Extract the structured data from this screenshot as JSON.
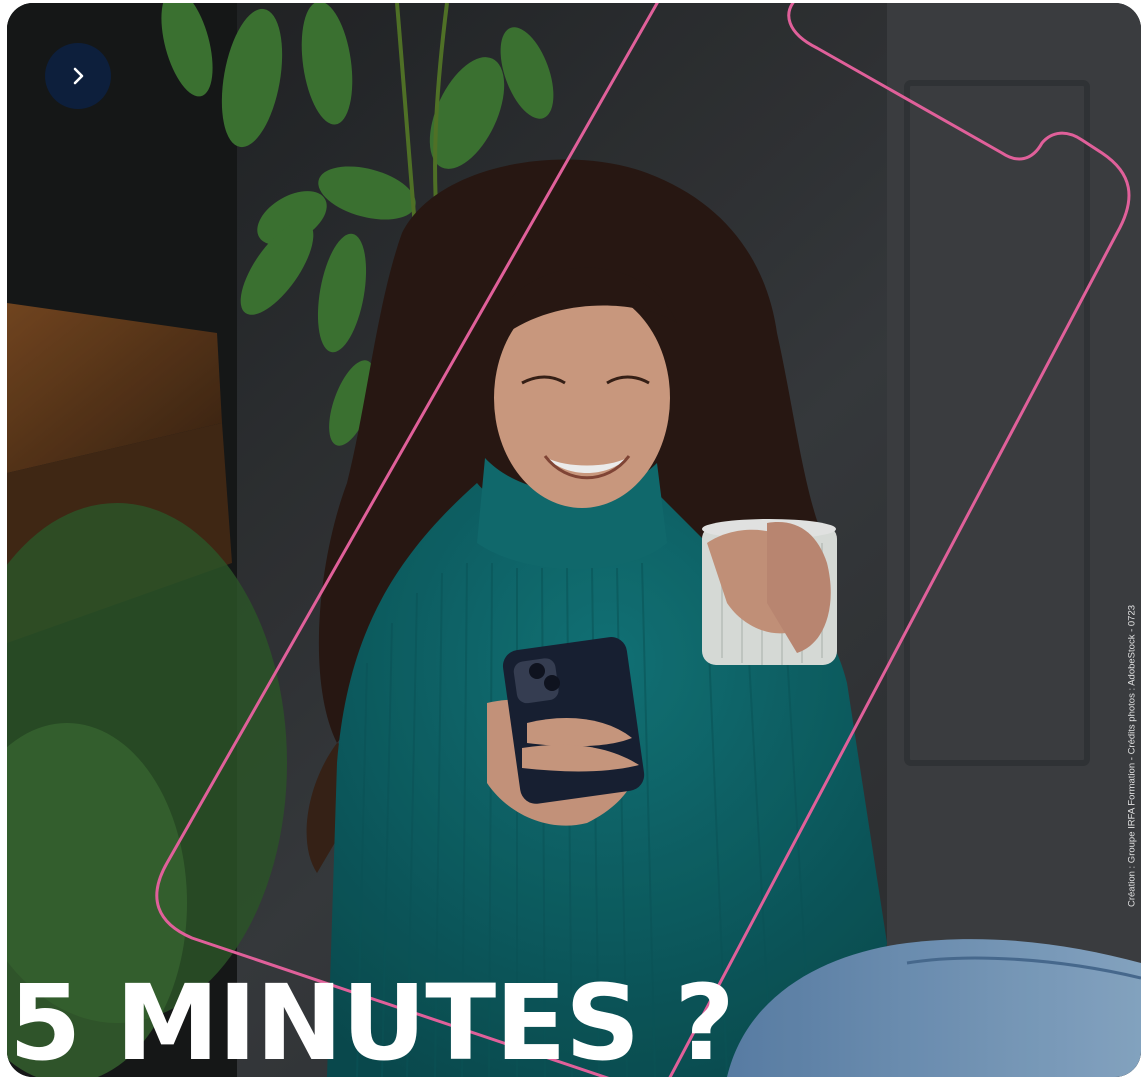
{
  "headline": "5 MINUTES ?",
  "credit": "Création : Groupe IRFA Formation - Crédits photos : AdobeStock - 0723",
  "next_button": {
    "icon": "chevron-right-icon"
  },
  "colors": {
    "accent_outline": "#e0609a",
    "button_bg": "#0d1f3c",
    "sweater": "#0f6a6e",
    "background": "#2e3134"
  }
}
